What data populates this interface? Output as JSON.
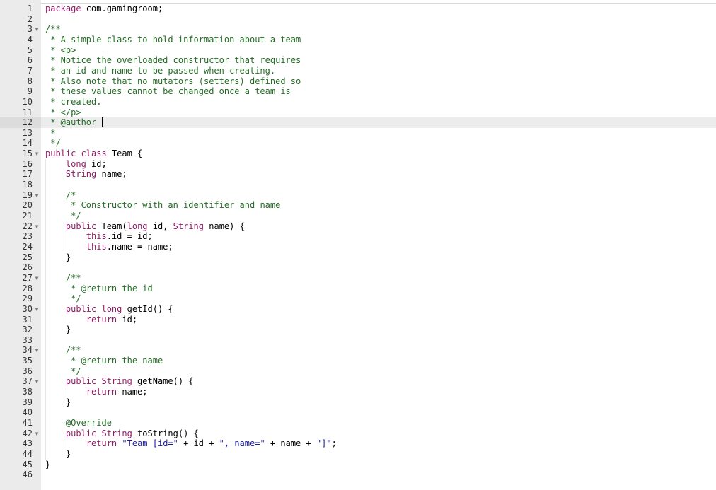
{
  "editor": {
    "active_line": 12,
    "lines": [
      {
        "n": "1",
        "t": [
          {
            "c": "k",
            "v": "package"
          },
          {
            "c": "",
            "v": " com.gamingroom;"
          }
        ]
      },
      {
        "n": "2",
        "t": []
      },
      {
        "n": "3",
        "fold": true,
        "t": [
          {
            "c": "c",
            "v": "/**"
          }
        ]
      },
      {
        "n": "4",
        "t": [
          {
            "c": "c",
            "v": " * A simple class to hold information about a team"
          }
        ]
      },
      {
        "n": "5",
        "t": [
          {
            "c": "c",
            "v": " * <p>"
          }
        ]
      },
      {
        "n": "6",
        "t": [
          {
            "c": "c",
            "v": " * Notice the overloaded constructor that requires"
          }
        ]
      },
      {
        "n": "7",
        "t": [
          {
            "c": "c",
            "v": " * an id and name to be passed when creating."
          }
        ]
      },
      {
        "n": "8",
        "t": [
          {
            "c": "c",
            "v": " * Also note that no mutators (setters) defined so"
          }
        ]
      },
      {
        "n": "9",
        "t": [
          {
            "c": "c",
            "v": " * these values cannot be changed once a team is"
          }
        ]
      },
      {
        "n": "10",
        "t": [
          {
            "c": "c",
            "v": " * created."
          }
        ]
      },
      {
        "n": "11",
        "t": [
          {
            "c": "c",
            "v": " * </p>"
          }
        ]
      },
      {
        "n": "12",
        "t": [
          {
            "c": "c",
            "v": " * @author "
          }
        ],
        "cursor": true
      },
      {
        "n": "13",
        "t": [
          {
            "c": "c",
            "v": " *"
          }
        ]
      },
      {
        "n": "14",
        "t": [
          {
            "c": "c",
            "v": " */"
          }
        ]
      },
      {
        "n": "15",
        "fold": true,
        "t": [
          {
            "c": "k",
            "v": "public class"
          },
          {
            "c": "",
            "v": " Team {"
          }
        ]
      },
      {
        "n": "16",
        "t": [
          {
            "c": "",
            "v": "    "
          },
          {
            "c": "k",
            "v": "long"
          },
          {
            "c": "",
            "v": " id;"
          }
        ]
      },
      {
        "n": "17",
        "t": [
          {
            "c": "",
            "v": "    "
          },
          {
            "c": "k",
            "v": "String"
          },
          {
            "c": "",
            "v": " name;"
          }
        ]
      },
      {
        "n": "18",
        "t": []
      },
      {
        "n": "19",
        "fold": true,
        "t": [
          {
            "c": "",
            "v": "    "
          },
          {
            "c": "c",
            "v": "/*"
          }
        ]
      },
      {
        "n": "20",
        "t": [
          {
            "c": "",
            "v": "    "
          },
          {
            "c": "c",
            "v": " * Constructor with an identifier and name"
          }
        ]
      },
      {
        "n": "21",
        "t": [
          {
            "c": "",
            "v": "    "
          },
          {
            "c": "c",
            "v": " */"
          }
        ]
      },
      {
        "n": "22",
        "fold": true,
        "t": [
          {
            "c": "",
            "v": "    "
          },
          {
            "c": "k",
            "v": "public"
          },
          {
            "c": "",
            "v": " Team("
          },
          {
            "c": "k",
            "v": "long"
          },
          {
            "c": "",
            "v": " id, "
          },
          {
            "c": "k",
            "v": "String"
          },
          {
            "c": "",
            "v": " name) {"
          }
        ]
      },
      {
        "n": "23",
        "t": [
          {
            "c": "",
            "v": "        "
          },
          {
            "c": "k",
            "v": "this"
          },
          {
            "c": "",
            "v": ".id = id;"
          }
        ]
      },
      {
        "n": "24",
        "t": [
          {
            "c": "",
            "v": "        "
          },
          {
            "c": "k",
            "v": "this"
          },
          {
            "c": "",
            "v": ".name = name;"
          }
        ]
      },
      {
        "n": "25",
        "t": [
          {
            "c": "",
            "v": "    }"
          }
        ]
      },
      {
        "n": "26",
        "t": []
      },
      {
        "n": "27",
        "fold": true,
        "t": [
          {
            "c": "",
            "v": "    "
          },
          {
            "c": "c",
            "v": "/**"
          }
        ]
      },
      {
        "n": "28",
        "t": [
          {
            "c": "",
            "v": "    "
          },
          {
            "c": "c",
            "v": " * @return the id"
          }
        ]
      },
      {
        "n": "29",
        "t": [
          {
            "c": "",
            "v": "    "
          },
          {
            "c": "c",
            "v": " */"
          }
        ]
      },
      {
        "n": "30",
        "fold": true,
        "t": [
          {
            "c": "",
            "v": "    "
          },
          {
            "c": "k",
            "v": "public long"
          },
          {
            "c": "",
            "v": " getId() {"
          }
        ]
      },
      {
        "n": "31",
        "t": [
          {
            "c": "",
            "v": "        "
          },
          {
            "c": "k",
            "v": "return"
          },
          {
            "c": "",
            "v": " id;"
          }
        ]
      },
      {
        "n": "32",
        "t": [
          {
            "c": "",
            "v": "    }"
          }
        ]
      },
      {
        "n": "33",
        "t": []
      },
      {
        "n": "34",
        "fold": true,
        "t": [
          {
            "c": "",
            "v": "    "
          },
          {
            "c": "c",
            "v": "/**"
          }
        ]
      },
      {
        "n": "35",
        "t": [
          {
            "c": "",
            "v": "    "
          },
          {
            "c": "c",
            "v": " * @return the name"
          }
        ]
      },
      {
        "n": "36",
        "t": [
          {
            "c": "",
            "v": "    "
          },
          {
            "c": "c",
            "v": " */"
          }
        ]
      },
      {
        "n": "37",
        "fold": true,
        "t": [
          {
            "c": "",
            "v": "    "
          },
          {
            "c": "k",
            "v": "public String"
          },
          {
            "c": "",
            "v": " getName() {"
          }
        ]
      },
      {
        "n": "38",
        "t": [
          {
            "c": "",
            "v": "        "
          },
          {
            "c": "k",
            "v": "return"
          },
          {
            "c": "",
            "v": " name;"
          }
        ]
      },
      {
        "n": "39",
        "t": [
          {
            "c": "",
            "v": "    }"
          }
        ]
      },
      {
        "n": "40",
        "t": []
      },
      {
        "n": "41",
        "t": [
          {
            "c": "",
            "v": "    "
          },
          {
            "c": "c",
            "v": "@Override"
          }
        ]
      },
      {
        "n": "42",
        "fold": true,
        "t": [
          {
            "c": "",
            "v": "    "
          },
          {
            "c": "k",
            "v": "public String"
          },
          {
            "c": "",
            "v": " toString() {"
          }
        ]
      },
      {
        "n": "43",
        "t": [
          {
            "c": "",
            "v": "        "
          },
          {
            "c": "k",
            "v": "return"
          },
          {
            "c": "",
            "v": " "
          },
          {
            "c": "s",
            "v": "\"Team [id=\""
          },
          {
            "c": "",
            "v": " + id + "
          },
          {
            "c": "s",
            "v": "\", name=\""
          },
          {
            "c": "",
            "v": " + name + "
          },
          {
            "c": "s",
            "v": "\"]\""
          },
          {
            "c": "",
            "v": ";"
          }
        ]
      },
      {
        "n": "44",
        "t": [
          {
            "c": "",
            "v": "    }"
          }
        ]
      },
      {
        "n": "45",
        "t": [
          {
            "c": "",
            "v": "}"
          }
        ]
      },
      {
        "n": "46",
        "t": []
      }
    ]
  }
}
